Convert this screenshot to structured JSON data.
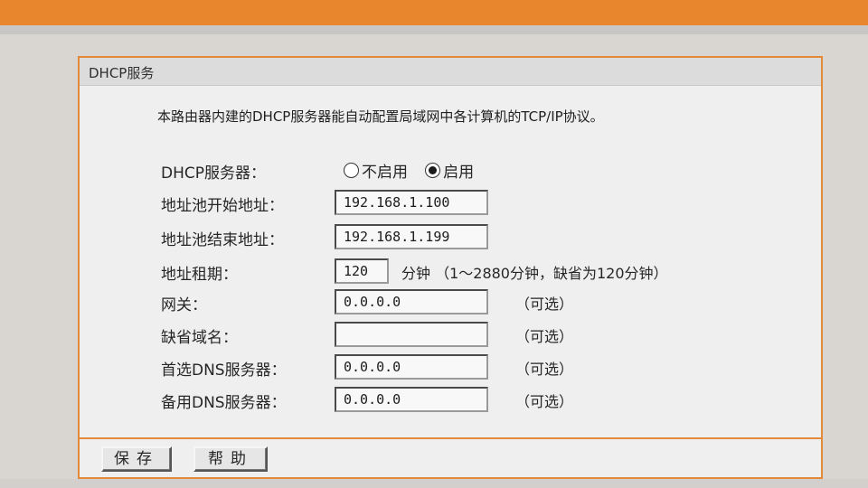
{
  "panel": {
    "title": "DHCP服务",
    "description": "本路由器内建的DHCP服务器能自动配置局域网中各计算机的TCP/IP协议。"
  },
  "form": {
    "dhcp_server": {
      "label": "DHCP服务器：",
      "options": [
        "不启用",
        "启用"
      ],
      "selected": "启用"
    },
    "start_address": {
      "label": "地址池开始地址：",
      "value": "192.168.1.100"
    },
    "end_address": {
      "label": "地址池结束地址：",
      "value": "192.168.1.199"
    },
    "lease_time": {
      "label": "地址租期：",
      "value": "120",
      "unit_hint": "分钟 （1～2880分钟，缺省为120分钟）"
    },
    "gateway": {
      "label": "网关：",
      "value": "0.0.0.0",
      "optional": "（可选）"
    },
    "default_domain": {
      "label": "缺省域名：",
      "value": "",
      "optional": "（可选）"
    },
    "primary_dns": {
      "label": "首选DNS服务器：",
      "value": "0.0.0.0",
      "optional": "（可选）"
    },
    "secondary_dns": {
      "label": "备用DNS服务器：",
      "value": "0.0.0.0",
      "optional": "（可选）"
    }
  },
  "buttons": {
    "save": "保存",
    "help": "帮助"
  },
  "colors": {
    "accent_orange": "#e38a3a",
    "panel_bg": "#efefef",
    "title_bar": "#dcdcdc"
  }
}
